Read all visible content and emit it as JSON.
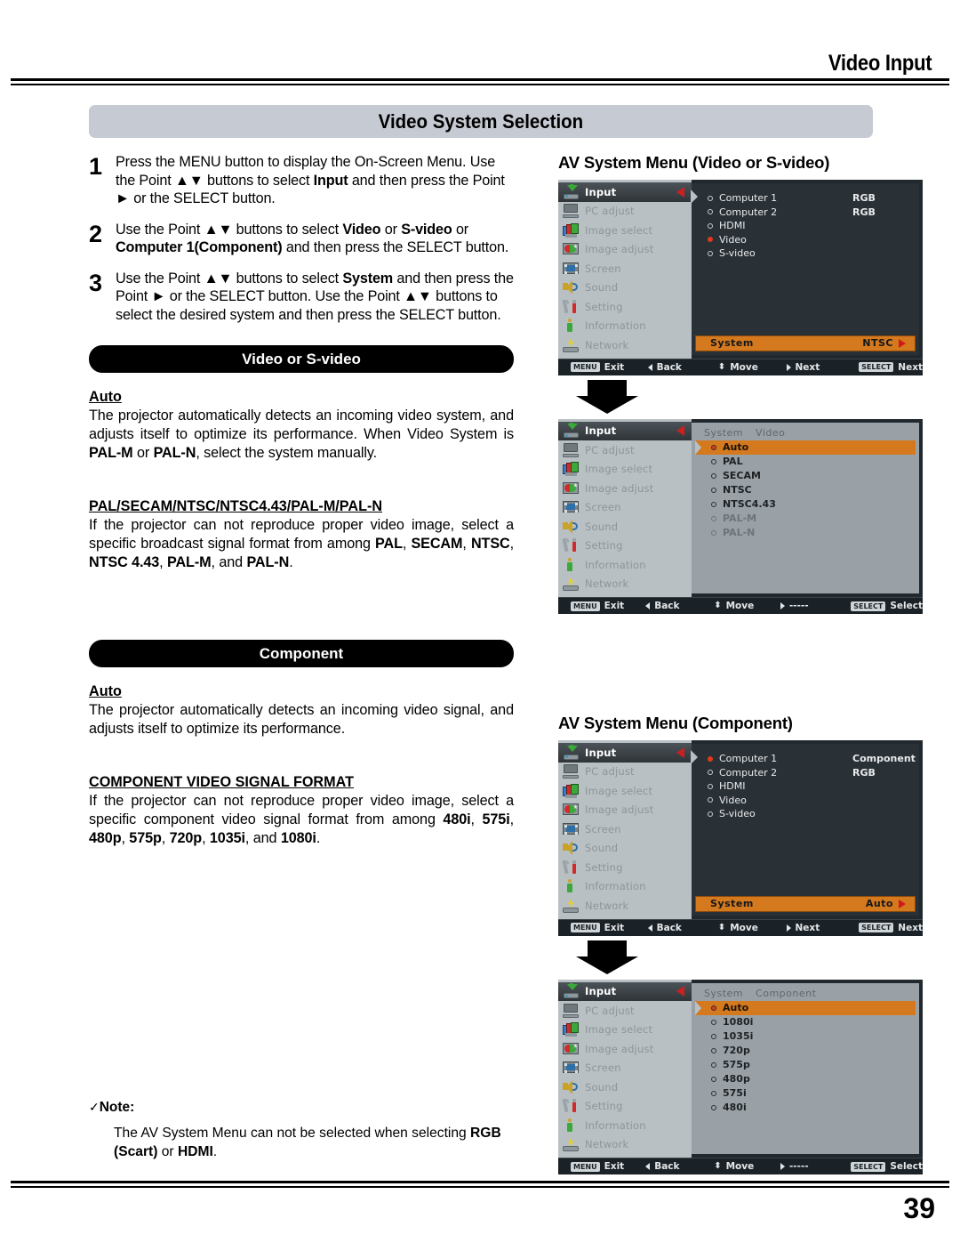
{
  "header": {
    "running_title": "Video Input",
    "banner_title": "Video System Selection"
  },
  "steps": [
    {
      "num": "1",
      "html": "Press the MENU button to display the On-Screen Menu. Use the Point ▲▼ buttons to select <b>Input</b> and then press the Point ► or the SELECT button."
    },
    {
      "num": "2",
      "html": "Use the Point ▲▼ buttons to select <b>Video</b> or <b>S-video</b> or <b>Computer 1(Component)</b> and then press the SELECT button."
    },
    {
      "num": "3",
      "html": "Use the Point ▲▼ buttons to select <b>System</b> and then press the Point ► or the SELECT button. Use the Point ▲▼ buttons to select the desired system and then press the SELECT button."
    }
  ],
  "section_video": {
    "bar_label": "Video or S-video",
    "auto_heading": "Auto",
    "auto_body": "The projector automatically detects an incoming video system, and adjusts itself to optimize its performance. When Video System is <b>PAL-M</b> or <b>PAL-N</b>, select the system manually.",
    "formats_heading": "PAL/SECAM/NTSC/NTSC4.43/PAL-M/PAL-N",
    "formats_body": "If the projector can not reproduce proper video image, select a specific broadcast signal format from among <b>PAL</b>, <b>SECAM</b>, <b>NTSC</b>, <b>NTSC 4.43</b>, <b>PAL-M</b>, and <b>PAL-N</b>."
  },
  "section_component": {
    "bar_label": "Component",
    "auto_heading": "Auto",
    "auto_body": "The projector automatically detects an incoming video signal, and adjusts itself to optimize its performance.",
    "formats_heading": "COMPONENT VIDEO SIGNAL FORMAT",
    "formats_body": "If the projector can not reproduce proper video image, select a specific component video signal format from among <b>480i</b>, <b>575i</b>, <b>480p</b>, <b>575p</b>, <b>720p</b>, <b>1035i</b>, and <b>1080i</b>."
  },
  "note": {
    "tick": "✓",
    "title": "Note:",
    "body": "The AV System Menu can not be selected when selecting <b>RGB (Scart)</b> or <b>HDMI</b>."
  },
  "footer": {
    "page_number": "39"
  },
  "osd": {
    "sidebar": [
      {
        "label": "Input",
        "icon": "input-icon"
      },
      {
        "label": "PC adjust",
        "icon": "monitor-icon"
      },
      {
        "label": "Image select",
        "icon": "image-select-icon"
      },
      {
        "label": "Image adjust",
        "icon": "image-adjust-icon"
      },
      {
        "label": "Screen",
        "icon": "screen-icon"
      },
      {
        "label": "Sound",
        "icon": "speaker-icon"
      },
      {
        "label": "Setting",
        "icon": "tools-icon"
      },
      {
        "label": "Information",
        "icon": "info-icon"
      },
      {
        "label": "Network",
        "icon": "network-icon"
      }
    ],
    "status_next": {
      "exit_key": "MENU",
      "exit": "Exit",
      "back": "Back",
      "move": "Move",
      "next_point": "Next",
      "select_key": "SELECT",
      "select": "Next"
    },
    "status_select": {
      "exit_key": "MENU",
      "exit": "Exit",
      "back": "Back",
      "move": "Move",
      "next_point": "-----",
      "select_key": "SELECT",
      "select": "Select"
    }
  },
  "menu_video": {
    "title": "AV System Menu (Video or S-video)",
    "inputs": [
      {
        "name": "Computer 1",
        "value": "RGB",
        "selected": false
      },
      {
        "name": "Computer 2",
        "value": "RGB",
        "selected": false
      },
      {
        "name": "HDMI",
        "value": "",
        "selected": false
      },
      {
        "name": "Video",
        "value": "",
        "selected": true
      },
      {
        "name": "S-video",
        "value": "",
        "selected": false
      }
    ],
    "system_label": "System",
    "system_value": "NTSC"
  },
  "menu_video_sub": {
    "head_left": "System",
    "head_right": "Video",
    "options": [
      {
        "label": "Auto",
        "selected": true,
        "dim": false
      },
      {
        "label": "PAL",
        "selected": false,
        "dim": false
      },
      {
        "label": "SECAM",
        "selected": false,
        "dim": false
      },
      {
        "label": "NTSC",
        "selected": false,
        "dim": false
      },
      {
        "label": "NTSC4.43",
        "selected": false,
        "dim": false
      },
      {
        "label": "PAL-M",
        "selected": false,
        "dim": true
      },
      {
        "label": "PAL-N",
        "selected": false,
        "dim": true
      }
    ]
  },
  "menu_component": {
    "title": "AV System Menu (Component)",
    "inputs": [
      {
        "name": "Computer 1",
        "value": "Component",
        "selected": true
      },
      {
        "name": "Computer 2",
        "value": "RGB",
        "selected": false
      },
      {
        "name": "HDMI",
        "value": "",
        "selected": false
      },
      {
        "name": "Video",
        "value": "",
        "selected": false
      },
      {
        "name": "S-video",
        "value": "",
        "selected": false
      }
    ],
    "system_label": "System",
    "system_value": "Auto"
  },
  "menu_component_sub": {
    "head_left": "System",
    "head_right": "Component",
    "options": [
      {
        "label": "Auto",
        "selected": true,
        "dim": false
      },
      {
        "label": "1080i",
        "selected": false,
        "dim": false
      },
      {
        "label": "1035i",
        "selected": false,
        "dim": false
      },
      {
        "label": "720p",
        "selected": false,
        "dim": false
      },
      {
        "label": "575p",
        "selected": false,
        "dim": false
      },
      {
        "label": "480p",
        "selected": false,
        "dim": false
      },
      {
        "label": "575i",
        "selected": false,
        "dim": false
      },
      {
        "label": "480i",
        "selected": false,
        "dim": false
      }
    ]
  }
}
